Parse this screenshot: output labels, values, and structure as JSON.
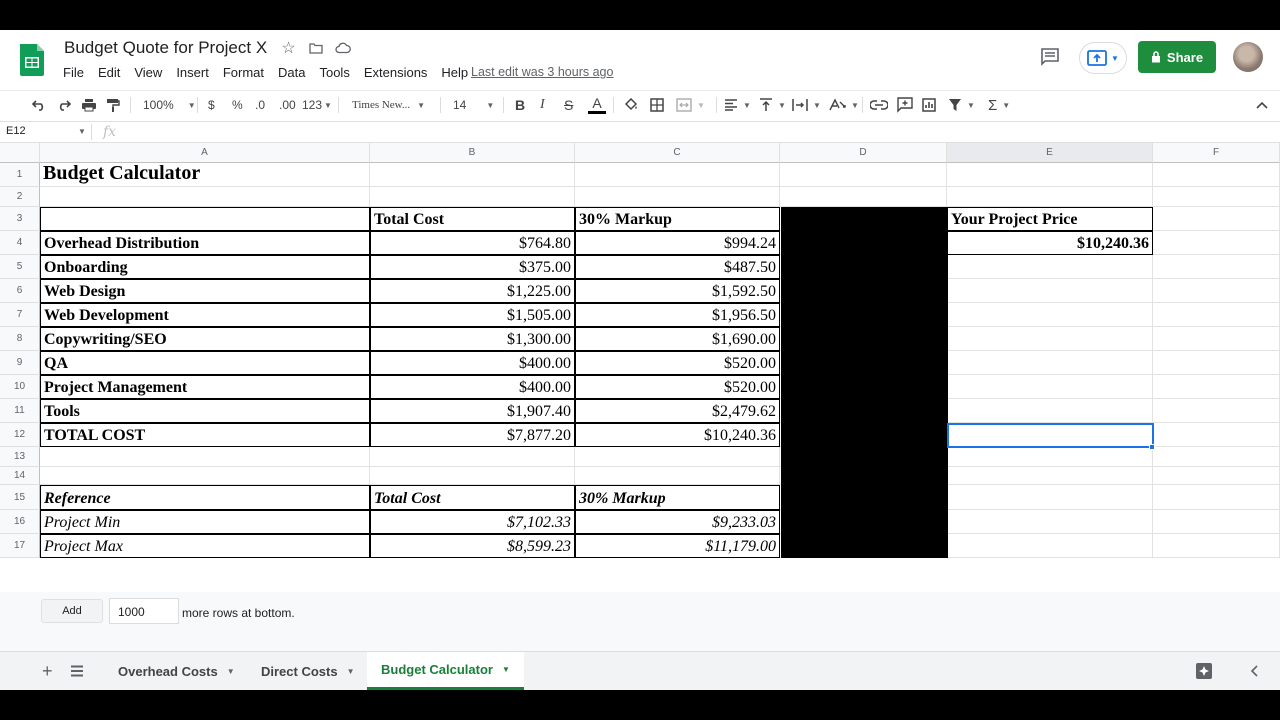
{
  "app": {
    "doc_title": "Budget Quote for Project X",
    "menu": [
      "File",
      "Edit",
      "View",
      "Insert",
      "Format",
      "Data",
      "Tools",
      "Extensions",
      "Help"
    ],
    "last_edit": "Last edit was 3 hours ago",
    "share_label": "Share",
    "colors": {
      "sheets_green": "#0f9d58",
      "share_green": "#1e8e3e",
      "selection_blue": "#1a73e8"
    }
  },
  "toolbar": {
    "zoom": "100%",
    "currency": "$",
    "percent": "%",
    "dec_decrease": ".0",
    "dec_increase": ".00",
    "format_more": "123",
    "font": "Times New...",
    "font_size": "14"
  },
  "formula_bar": {
    "name_box": "E12",
    "fx": "fx"
  },
  "columns": [
    "A",
    "B",
    "C",
    "D",
    "E",
    "F"
  ],
  "rows": [
    "1",
    "2",
    "3",
    "4",
    "5",
    "6",
    "7",
    "8",
    "9",
    "10",
    "11",
    "12",
    "13",
    "14",
    "15",
    "16",
    "17"
  ],
  "sheet": {
    "title": "Budget Calculator",
    "headers": {
      "total_cost": "Total Cost",
      "markup": "30% Markup",
      "price": "Your Project Price"
    },
    "project_price": "$10,240.36",
    "items": [
      {
        "name": "Overhead Distribution",
        "total": "$764.80",
        "markup": "$994.24"
      },
      {
        "name": "Onboarding",
        "total": "$375.00",
        "markup": "$487.50"
      },
      {
        "name": "Web Design",
        "total": "$1,225.00",
        "markup": "$1,592.50"
      },
      {
        "name": "Web Development",
        "total": "$1,505.00",
        "markup": "$1,956.50"
      },
      {
        "name": "Copywriting/SEO",
        "total": "$1,300.00",
        "markup": "$1,690.00"
      },
      {
        "name": "QA",
        "total": "$400.00",
        "markup": "$520.00"
      },
      {
        "name": "Project Management",
        "total": "$400.00",
        "markup": "$520.00"
      },
      {
        "name": "Tools",
        "total": "$1,907.40",
        "markup": "$2,479.62"
      },
      {
        "name": "TOTAL COST",
        "total": "$7,877.20",
        "markup": "$10,240.36"
      }
    ],
    "reference": {
      "label": "Reference",
      "total_cost": "Total Cost",
      "markup": "30% Markup",
      "rows": [
        {
          "name": "Project Min",
          "total": "$7,102.33",
          "markup": "$9,233.03"
        },
        {
          "name": "Project Max",
          "total": "$8,599.23",
          "markup": "$11,179.00"
        }
      ]
    }
  },
  "add_rows": {
    "button": "Add",
    "value": "1000",
    "text": "more rows at bottom."
  },
  "tabs": [
    {
      "label": "Overhead Costs",
      "active": false
    },
    {
      "label": "Direct Costs",
      "active": false
    },
    {
      "label": "Budget Calculator",
      "active": true
    }
  ]
}
